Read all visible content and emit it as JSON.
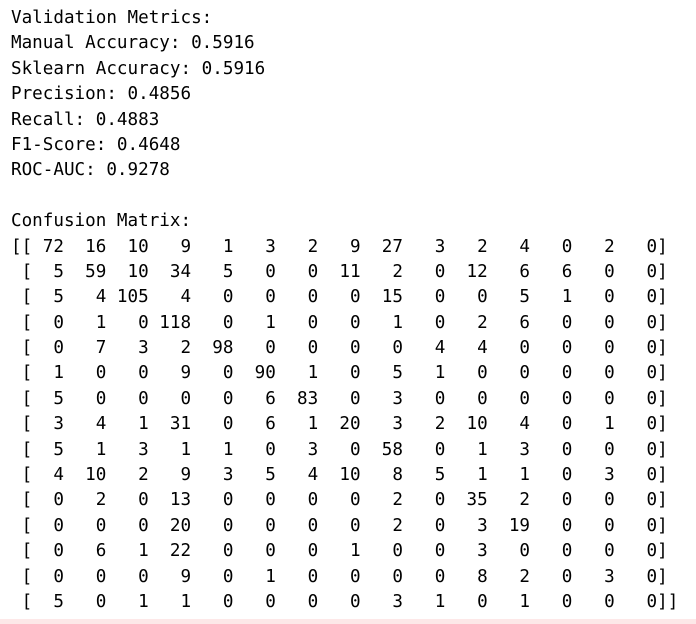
{
  "metrics": {
    "header": "Validation Metrics:",
    "manual_accuracy": "Manual Accuracy: 0.5916",
    "sklearn_accuracy": "Sklearn Accuracy: 0.5916",
    "precision": "Precision: 0.4856",
    "recall": "Recall: 0.4883",
    "f1": "F1-Score: 0.4648",
    "roc_auc": "ROC-AUC: 0.9278"
  },
  "confusion": {
    "header": "Confusion Matrix:",
    "rows": [
      "[[ 72  16  10   9   1   3   2   9  27   3   2   4   0   2   0]",
      " [  5  59  10  34   5   0   0  11   2   0  12   6   6   0   0]",
      " [  5   4 105   4   0   0   0   0  15   0   0   5   1   0   0]",
      " [  0   1   0 118   0   1   0   0   1   0   2   6   0   0   0]",
      " [  0   7   3   2  98   0   0   0   0   4   4   0   0   0   0]",
      " [  1   0   0   9   0  90   1   0   5   1   0   0   0   0   0]",
      " [  5   0   0   0   0   6  83   0   3   0   0   0   0   0   0]",
      " [  3   4   1  31   0   6   1  20   3   2  10   4   0   1   0]",
      " [  5   1   3   1   1   0   3   0  58   0   1   3   0   0   0]",
      " [  4  10   2   9   3   5   4  10   8   5   1   1   0   3   0]",
      " [  0   2   0  13   0   0   0   0   2   0  35   2   0   0   0]",
      " [  0   0   0  20   0   0   0   0   2   0   3  19   0   0   0]",
      " [  0   6   1  22   0   0   0   1   0   0   3   0   0   0   0]",
      " [  0   0   0   9   0   1   0   0   0   0   8   2   0   3   0]",
      " [  5   0   1   1   0   0   0   0   3   1   0   1   0   0   0]]"
    ]
  }
}
